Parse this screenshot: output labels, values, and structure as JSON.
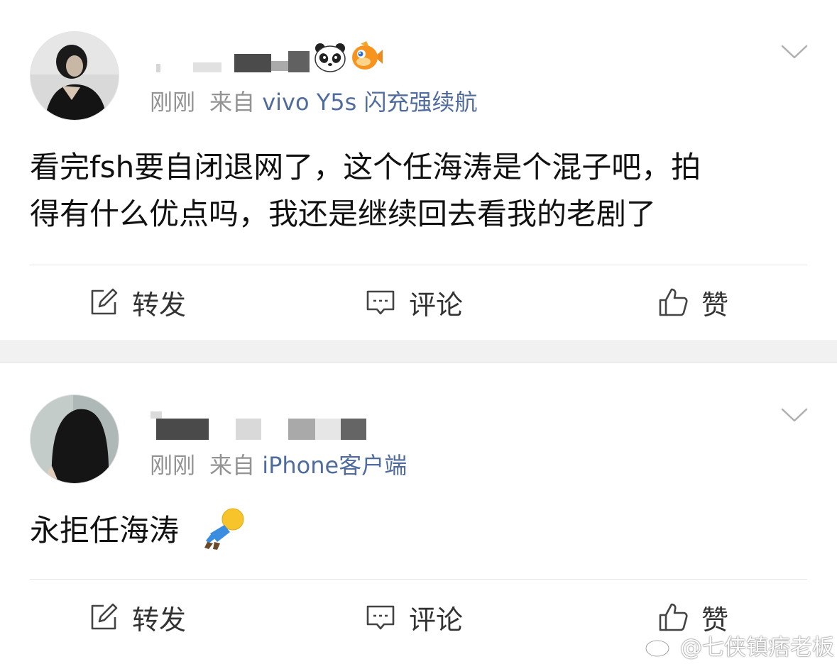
{
  "posts": [
    {
      "time": "刚刚",
      "source_prefix": "来自",
      "device": "vivo Y5s 闪充强续航",
      "content_lines": [
        "看完fsh要自闭退网了，这个任海涛是个混子吧，拍",
        "得有什么优点吗，我还是继续回去看我的老剧了"
      ],
      "name_emojis": [
        "panda-emoji-icon",
        "fish-emoji-icon"
      ],
      "actions": {
        "repost": "转发",
        "comment": "评论",
        "like": "赞"
      }
    },
    {
      "time": "刚刚",
      "source_prefix": "来自",
      "device": "iPhone客户端",
      "content_lines": [
        "永拒任海涛"
      ],
      "content_emoji": "lying-down-emoji-icon",
      "actions": {
        "repost": "转发",
        "comment": "评论",
        "like": "赞"
      }
    }
  ],
  "watermark": "@七侠镇痞老板",
  "colors": {
    "link_blue": "#506c9f",
    "meta_gray": "#939393",
    "text": "#111111",
    "separator": "#f1f1f2"
  }
}
